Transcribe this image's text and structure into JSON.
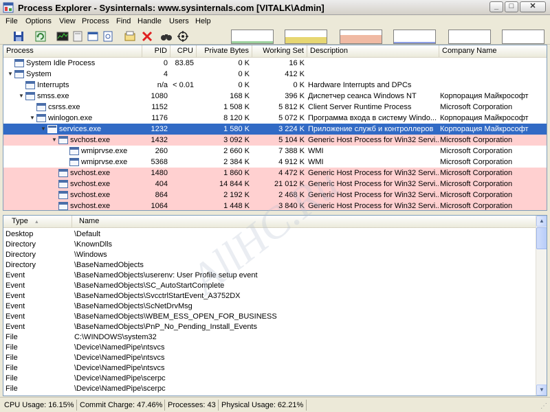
{
  "window": {
    "title": "Process Explorer - Sysinternals: www.sysinternals.com [VITALK\\Admin]",
    "min_glyph": "_",
    "max_glyph": "□",
    "close_glyph": "✕"
  },
  "menu": [
    {
      "label": "File"
    },
    {
      "label": "Options"
    },
    {
      "label": "View"
    },
    {
      "label": "Process"
    },
    {
      "label": "Find"
    },
    {
      "label": "Handle"
    },
    {
      "label": "Users"
    },
    {
      "label": "Help"
    }
  ],
  "toolbar": {
    "icons": [
      "save-icon",
      "refresh-icon",
      "system-info-icon",
      "dll-view-icon",
      "window-icon",
      "properties-icon",
      "target-icon",
      "kill-process-icon",
      "find-icon",
      "crosshair-icon"
    ],
    "graphs": [
      {
        "name": "cpu-graph",
        "color": "#4CAF50",
        "level": 0.16
      },
      {
        "name": "commit-graph",
        "color": "#D4B800",
        "level": 0.47
      },
      {
        "name": "io-graph",
        "color": "#E5835A",
        "level": 0.62
      },
      {
        "name": "network-graph",
        "color": "#3050D0",
        "level": 0.08
      },
      {
        "name": "disk-graph",
        "color": "#888888",
        "level": 0.0
      },
      {
        "name": "gpu-graph",
        "color": "#888888",
        "level": 0.0
      }
    ]
  },
  "process_table": {
    "columns": [
      "Process",
      "PID",
      "CPU",
      "Private Bytes",
      "Working Set",
      "Description",
      "Company Name"
    ],
    "rows": [
      {
        "name": "System Idle Process",
        "pid": "0",
        "cpu": "83.85",
        "private": "0 K",
        "working": "16 K",
        "desc": "",
        "company": "",
        "depth": 0,
        "expand": "",
        "style": ""
      },
      {
        "name": "System",
        "pid": "4",
        "cpu": "",
        "private": "0 K",
        "working": "412 K",
        "desc": "",
        "company": "",
        "depth": 0,
        "expand": "▼",
        "style": ""
      },
      {
        "name": "Interrupts",
        "pid": "n/a",
        "cpu": "< 0.01",
        "private": "0 K",
        "working": "0 K",
        "desc": "Hardware Interrupts and DPCs",
        "company": "",
        "depth": 1,
        "expand": "",
        "style": ""
      },
      {
        "name": "smss.exe",
        "pid": "1080",
        "cpu": "",
        "private": "168 K",
        "working": "396 K",
        "desc": "Диспетчер сеанса  Windows NT",
        "company": "Корпорация Майкрософт",
        "depth": 1,
        "expand": "▼",
        "style": ""
      },
      {
        "name": "csrss.exe",
        "pid": "1152",
        "cpu": "",
        "private": "1 508 K",
        "working": "5 812 K",
        "desc": "Client Server Runtime Process",
        "company": "Microsoft Corporation",
        "depth": 2,
        "expand": "",
        "style": ""
      },
      {
        "name": "winlogon.exe",
        "pid": "1176",
        "cpu": "",
        "private": "8 120 K",
        "working": "5 072 K",
        "desc": "Программа входа в систему Windo...",
        "company": "Корпорация Майкрософт",
        "depth": 2,
        "expand": "▼",
        "style": ""
      },
      {
        "name": "services.exe",
        "pid": "1232",
        "cpu": "",
        "private": "1 580 K",
        "working": "3 224 K",
        "desc": "Приложение служб и контроллеров",
        "company": "Корпорация Майкрософт",
        "depth": 3,
        "expand": "▼",
        "style": "sel"
      },
      {
        "name": "svchost.exe",
        "pid": "1432",
        "cpu": "",
        "private": "3 092 K",
        "working": "5 104 K",
        "desc": "Generic Host Process for Win32 Servi...",
        "company": "Microsoft Corporation",
        "depth": 4,
        "expand": "▼",
        "style": "pink"
      },
      {
        "name": "wmiprvse.exe",
        "pid": "260",
        "cpu": "",
        "private": "2 660 K",
        "working": "7 388 K",
        "desc": "WMI",
        "company": "Microsoft Corporation",
        "depth": 5,
        "expand": "",
        "style": ""
      },
      {
        "name": "wmiprvse.exe",
        "pid": "5368",
        "cpu": "",
        "private": "2 384 K",
        "working": "4 912 K",
        "desc": "WMI",
        "company": "Microsoft Corporation",
        "depth": 5,
        "expand": "",
        "style": ""
      },
      {
        "name": "svchost.exe",
        "pid": "1480",
        "cpu": "",
        "private": "1 860 K",
        "working": "4 472 K",
        "desc": "Generic Host Process for Win32 Servi...",
        "company": "Microsoft Corporation",
        "depth": 4,
        "expand": "",
        "style": "pink"
      },
      {
        "name": "svchost.exe",
        "pid": "404",
        "cpu": "",
        "private": "14 844 K",
        "working": "21 012 K",
        "desc": "Generic Host Process for Win32 Servi...",
        "company": "Microsoft Corporation",
        "depth": 4,
        "expand": "",
        "style": "pink"
      },
      {
        "name": "svchost.exe",
        "pid": "864",
        "cpu": "",
        "private": "2 192 K",
        "working": "2 468 K",
        "desc": "Generic Host Process for Win32 Servi...",
        "company": "Microsoft Corporation",
        "depth": 4,
        "expand": "",
        "style": "pink"
      },
      {
        "name": "svchost.exe",
        "pid": "1064",
        "cpu": "",
        "private": "1 448 K",
        "working": "3 840 K",
        "desc": "Generic Host Process for Win32 Servi...",
        "company": "Microsoft Corporation",
        "depth": 4,
        "expand": "",
        "style": "pink"
      }
    ]
  },
  "handle_table": {
    "columns": [
      "Type",
      "Name"
    ],
    "sort_glyph": "▲",
    "rows": [
      {
        "type": "Desktop",
        "name": "\\Default"
      },
      {
        "type": "Directory",
        "name": "\\KnownDlls"
      },
      {
        "type": "Directory",
        "name": "\\Windows"
      },
      {
        "type": "Directory",
        "name": "\\BaseNamedObjects"
      },
      {
        "type": "Event",
        "name": "\\BaseNamedObjects\\userenv:  User Profile setup event"
      },
      {
        "type": "Event",
        "name": "\\BaseNamedObjects\\SC_AutoStartComplete"
      },
      {
        "type": "Event",
        "name": "\\BaseNamedObjects\\SvcctrlStartEvent_A3752DX"
      },
      {
        "type": "Event",
        "name": "\\BaseNamedObjects\\ScNetDrvMsg"
      },
      {
        "type": "Event",
        "name": "\\BaseNamedObjects\\WBEM_ESS_OPEN_FOR_BUSINESS"
      },
      {
        "type": "Event",
        "name": "\\BaseNamedObjects\\PnP_No_Pending_Install_Events"
      },
      {
        "type": "File",
        "name": "C:\\WINDOWS\\system32"
      },
      {
        "type": "File",
        "name": "\\Device\\NamedPipe\\ntsvcs"
      },
      {
        "type": "File",
        "name": "\\Device\\NamedPipe\\ntsvcs"
      },
      {
        "type": "File",
        "name": "\\Device\\NamedPipe\\ntsvcs"
      },
      {
        "type": "File",
        "name": "\\Device\\NamedPipe\\scerpc"
      },
      {
        "type": "File",
        "name": "\\Device\\NamedPipe\\scerpc"
      }
    ]
  },
  "status": {
    "cpu": "CPU Usage: 16.15%",
    "commit": "Commit Charge: 47.46%",
    "processes": "Processes: 43",
    "physical": "Physical Usage: 62.21%"
  },
  "watermark": "AllHC.Ru"
}
